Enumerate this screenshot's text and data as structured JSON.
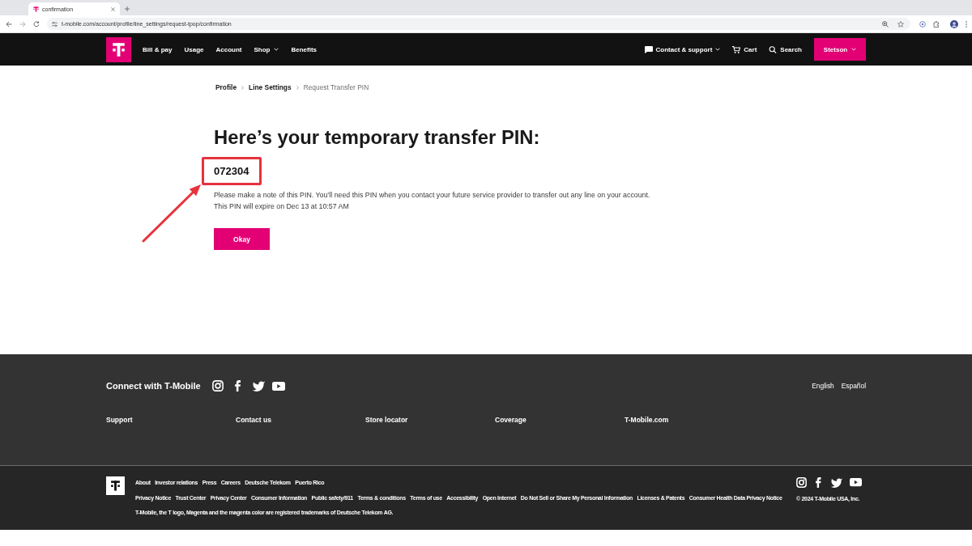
{
  "browser": {
    "tab_title": "confirmation",
    "url": "t-mobile.com/account/profile/line_settings/request-tpop/confirmation"
  },
  "nav": {
    "items": [
      {
        "label": "Bill & pay",
        "dropdown": false
      },
      {
        "label": "Usage",
        "dropdown": false
      },
      {
        "label": "Account",
        "dropdown": false
      },
      {
        "label": "Shop",
        "dropdown": true
      },
      {
        "label": "Benefits",
        "dropdown": false
      }
    ],
    "utilities": [
      {
        "kind": "chat",
        "label": "Contact & support",
        "dropdown": true
      },
      {
        "kind": "cart",
        "label": "Cart",
        "dropdown": false
      },
      {
        "kind": "search",
        "label": "Search",
        "dropdown": false
      }
    ],
    "account_button": {
      "label": "Stetson",
      "dropdown": true
    }
  },
  "breadcrumb": [
    {
      "label": "Profile",
      "current": false
    },
    {
      "label": "Line Settings",
      "current": false
    },
    {
      "label": "Request Transfer PIN",
      "current": true
    }
  ],
  "heading": "Here’s your temporary transfer PIN:",
  "pin": "072304",
  "message": [
    "Please make a note of this PIN. You’ll need this PIN when you contact your future service provider to transfer out any line on your account.",
    "This PIN will expire on Dec 13 at 10:57 AM"
  ],
  "okay_button": "Okay",
  "footer": {
    "connect_title": "Connect with T-Mobile",
    "languages": [
      "English",
      "Español"
    ],
    "links": [
      "Support",
      "Contact us",
      "Store locator",
      "Coverage",
      "T-Mobile.com"
    ],
    "legal_links_primary": [
      "About",
      "Investor relations",
      "Press",
      "Careers",
      "Deutsche Telekom",
      "Puerto Rico"
    ],
    "legal_links_secondary": [
      "Privacy Notice",
      "Trust Center",
      "Privacy Center",
      "Consumer Information",
      "Public safety/911",
      "Terms & conditions",
      "Terms of use",
      "Accessibility",
      "Open Internet",
      "Do Not Sell or Share My Personal Information",
      "Licenses & Patents",
      "Consumer Health Data Privacy Notice"
    ],
    "trademark": "T-Mobile, the T logo, Magenta and the magenta color are registered trademarks of Deutsche Telekom AG.",
    "copyright": "© 2024 T-Mobile USA, Inc."
  }
}
